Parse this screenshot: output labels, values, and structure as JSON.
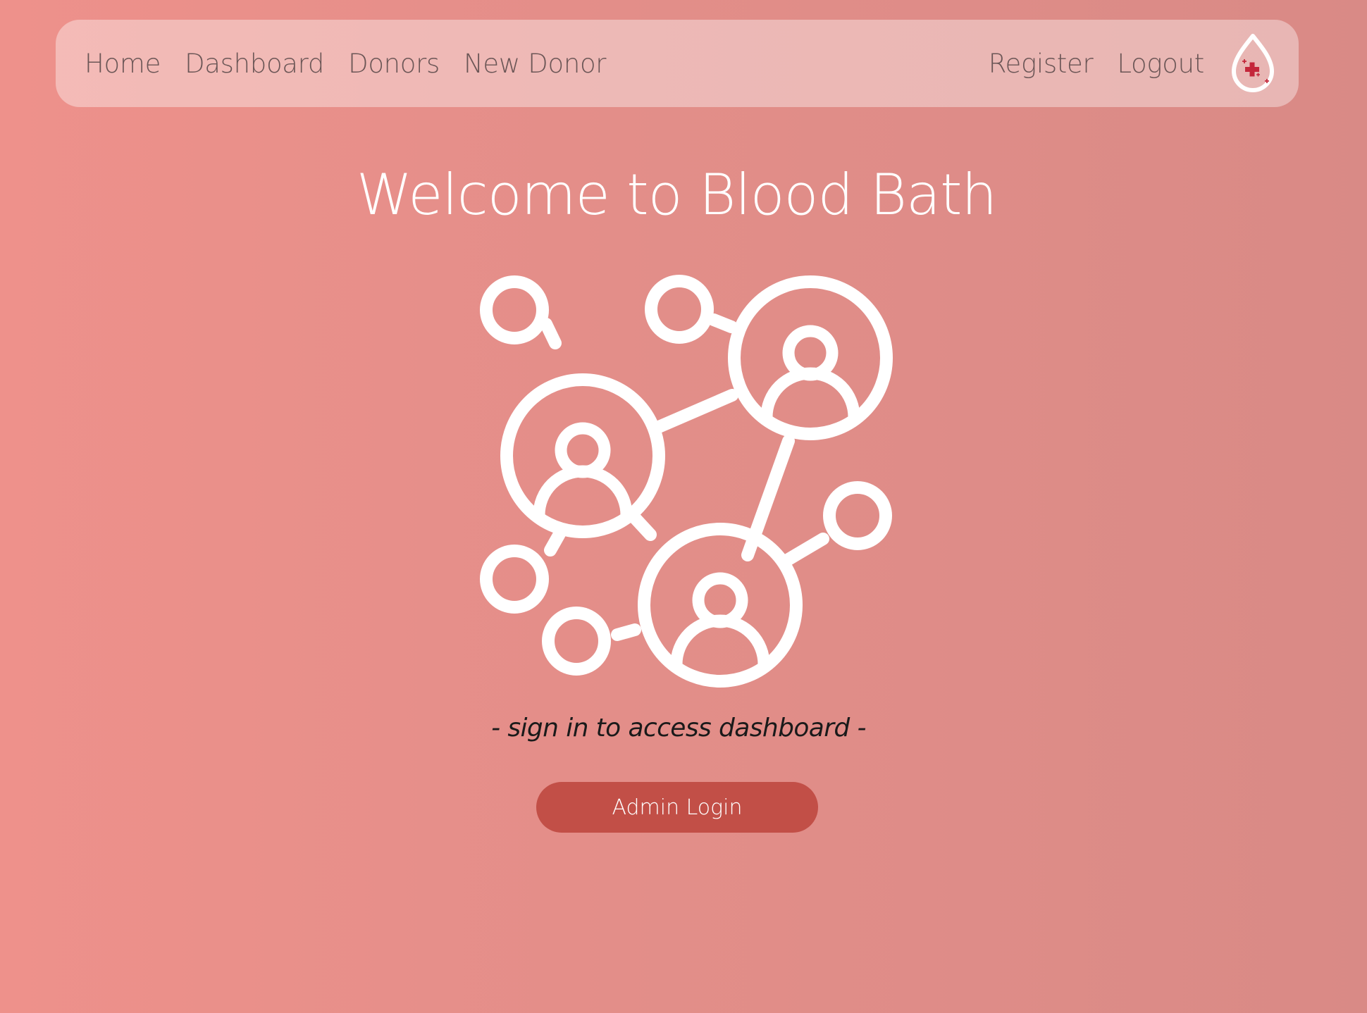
{
  "nav": {
    "left_links": [
      {
        "label": "Home"
      },
      {
        "label": "Dashboard"
      },
      {
        "label": "Donors"
      },
      {
        "label": "New Donor"
      }
    ],
    "right_links": [
      {
        "label": "Register"
      },
      {
        "label": "Logout"
      }
    ],
    "logo_icon": "blood-drop-plus-icon"
  },
  "main": {
    "title": "Welcome to Blood Bath",
    "hero_icon": "user-network-icon",
    "subtitle": "- sign in to access dashboard -",
    "login_button": "Admin Login"
  },
  "colors": {
    "background_start": "#ee918b",
    "background_end": "#d98a86",
    "nav_text": "#6b5656",
    "button_bg": "#c24f47",
    "logo_accent": "#c4273b",
    "text_light": "#ffffff"
  }
}
